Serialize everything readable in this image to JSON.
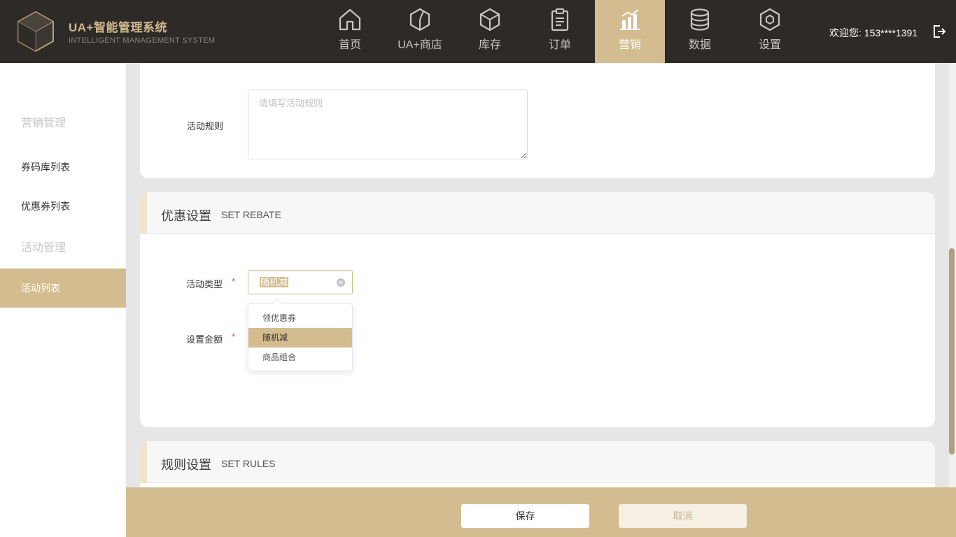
{
  "brand": {
    "title": "UA+智能管理系统",
    "subtitle": "INTELLIGENT MANAGEMENT SYSTEM",
    "accent_color": "#d3bc8f",
    "header_bg": "#2d2a28"
  },
  "nav": {
    "items": [
      {
        "label": "首页",
        "icon": "home-icon"
      },
      {
        "label": "UA+商店",
        "icon": "store-icon"
      },
      {
        "label": "库存",
        "icon": "box-icon"
      },
      {
        "label": "订单",
        "icon": "clipboard-icon"
      },
      {
        "label": "营销",
        "icon": "chart-icon",
        "active": true
      },
      {
        "label": "数据",
        "icon": "database-icon"
      },
      {
        "label": "设置",
        "icon": "hexagon-gear-icon"
      }
    ]
  },
  "user": {
    "welcome": "欢迎您: 153****1391"
  },
  "sidebar": {
    "section1": "营销管理",
    "link1": "券码库列表",
    "link2": "优惠券列表",
    "section2": "活动管理",
    "active": "活动列表"
  },
  "rules_form": {
    "label": "活动规则",
    "placeholder": "请填写活动规则"
  },
  "rebate": {
    "title": "优惠设置",
    "title_en": "SET REBATE",
    "type_label": "活动类型",
    "required_mark": "*",
    "type_value": "随机减",
    "amount_label": "设置金额",
    "options": [
      "领优惠券",
      "随机减",
      "商品组合"
    ],
    "selected_option": "随机减"
  },
  "rules_section": {
    "title": "规则设置",
    "title_en": "SET RULES"
  },
  "footer": {
    "save": "保存",
    "cancel": "取消"
  }
}
